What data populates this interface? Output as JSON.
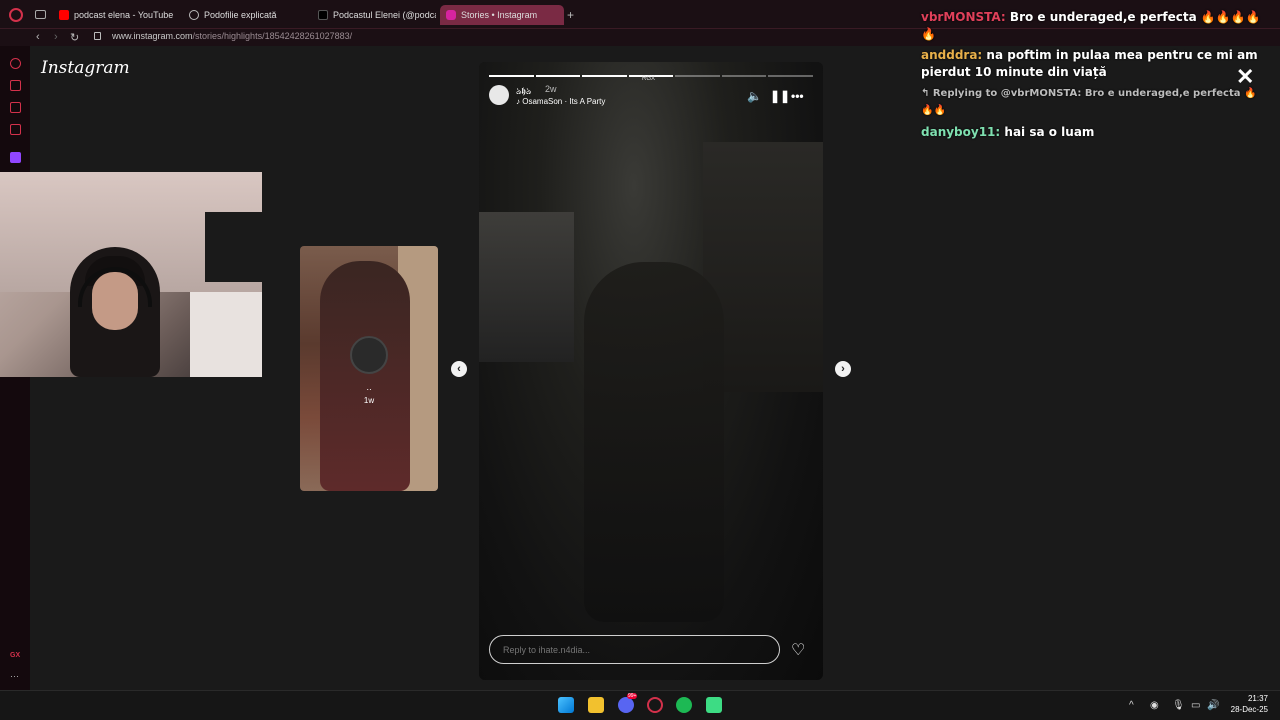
{
  "browser": {
    "tabs": [
      {
        "label": "podcast elena - YouTube",
        "color": "#ff0000"
      },
      {
        "label": "Podofilie explicată",
        "color": "#bbbbbb"
      },
      {
        "label": "Podcastul Elenei (@podca",
        "color": "#ffffff"
      },
      {
        "label": "Stories • Instagram",
        "color": "#d6249f"
      }
    ],
    "new_tab": "+",
    "url_main": "www.instagram.com",
    "url_path": "/stories/highlights/18542428261027883/"
  },
  "instagram": {
    "logo": "Instagram",
    "prev_story": {
      "username": "‥",
      "time": "1w"
    },
    "story": {
      "username": "ঌ𝖍ঌ",
      "time": "2w",
      "song": "OsamaSon · Its A Party",
      "sticker": "RGX",
      "reply_placeholder": "Reply to ihate.n4dia...",
      "progress_done": 4,
      "progress_total": 7
    }
  },
  "chat": {
    "messages": [
      {
        "user": "vbrMONSTA:",
        "text": "Bro e underaged,e perfecta 🔥🔥🔥🔥🔥",
        "color": "#e0405a"
      },
      {
        "user": "andddra:",
        "text": "na poftim in pulaa mea pentru ce mi am pierdut 10 minute din viață",
        "color": "#e8b04a"
      }
    ],
    "reply_context": "↰ Replying to @vbrMONSTA: Bro e underaged,e perfecta 🔥🔥🔥",
    "last": {
      "user": "danyboy11:",
      "text": "hai sa o luam",
      "color": "#7fe0b0"
    }
  },
  "taskbar": {
    "time": "21:37",
    "date": "28-Dec-25",
    "discord_badge": "99+"
  }
}
